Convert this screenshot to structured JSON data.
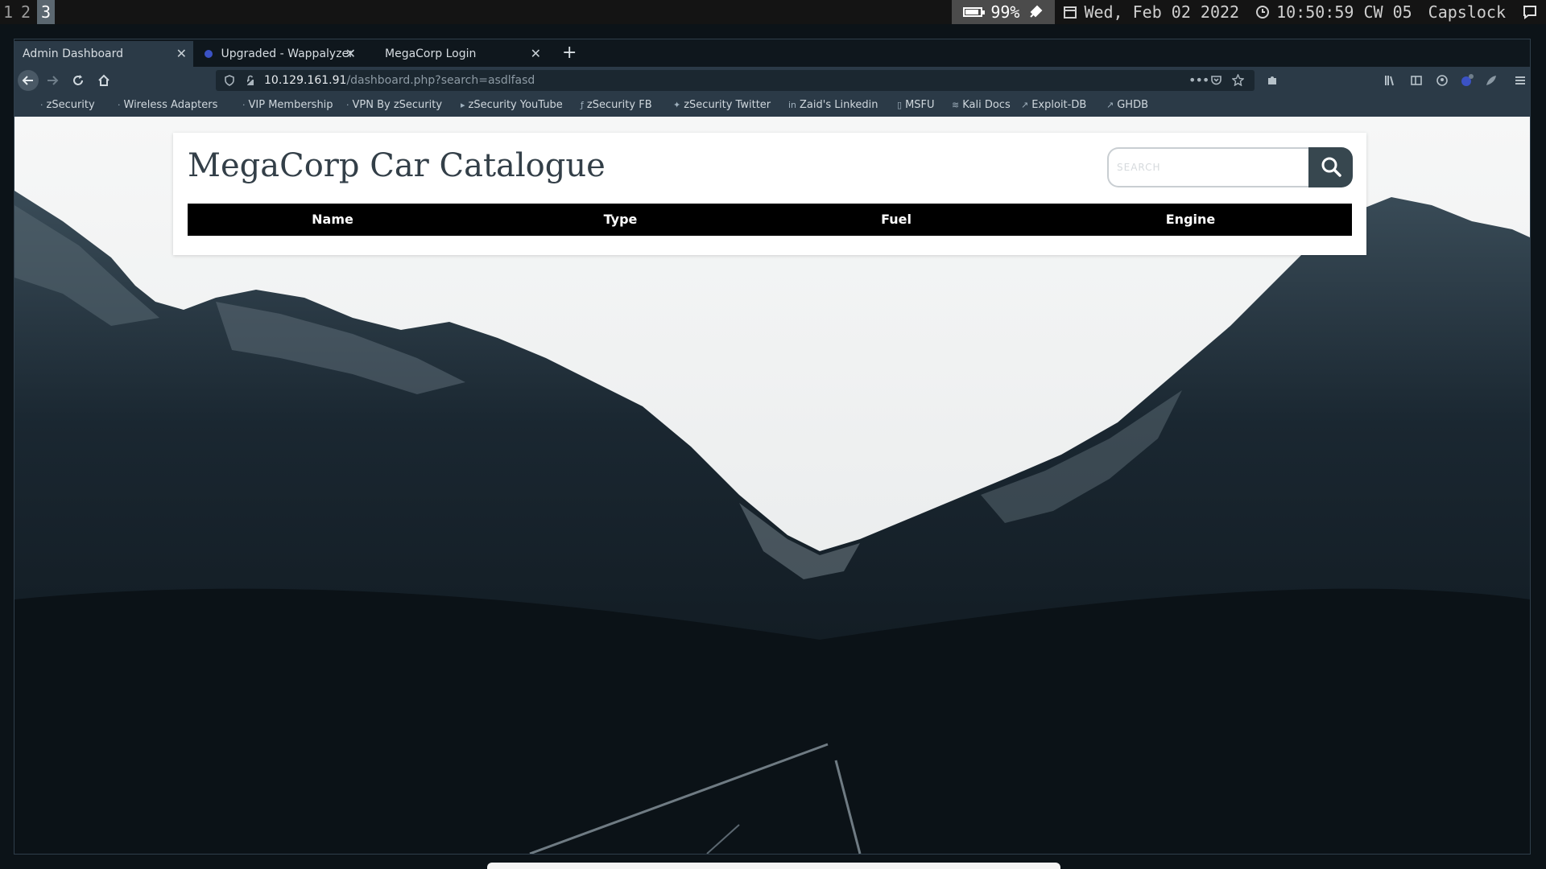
{
  "system_bar": {
    "workspaces": [
      "1",
      "2",
      "3"
    ],
    "active_workspace": "3",
    "battery_percent": "99%",
    "date": "Wed, Feb 02 2022",
    "time": "10:50:59 CW 05",
    "keyboard_state": "Capslock"
  },
  "browser": {
    "tabs": [
      {
        "title": "Admin Dashboard",
        "active": true
      },
      {
        "title": "Upgraded - Wappalyzer",
        "active": false
      },
      {
        "title": "MegaCorp Login",
        "active": false
      }
    ],
    "url": {
      "host": "10.129.161.91",
      "path": "/dashboard.php?search=asdlfasd"
    },
    "bookmarks": [
      "zSecurity",
      "Wireless Adapters",
      "VIP Membership",
      "VPN By zSecurity",
      "zSecurity YouTube",
      "zSecurity FB",
      "zSecurity Twitter",
      "Zaid's Linkedin",
      "MSFU",
      "Kali Docs",
      "Exploit-DB",
      "GHDB"
    ]
  },
  "page": {
    "title": "MegaCorp Car Catalogue",
    "search_placeholder": "SEARCH",
    "table_headers": [
      "Name",
      "Type",
      "Fuel",
      "Engine"
    ],
    "rows": []
  },
  "colors": {
    "accent_dark": "#37474f",
    "table_header_bg": "#000000",
    "browser_chrome": "#2b3a47"
  },
  "icons": {
    "search": "search-icon",
    "back": "back-arrow-icon",
    "forward": "forward-arrow-icon",
    "reload": "reload-icon",
    "home": "home-icon"
  }
}
